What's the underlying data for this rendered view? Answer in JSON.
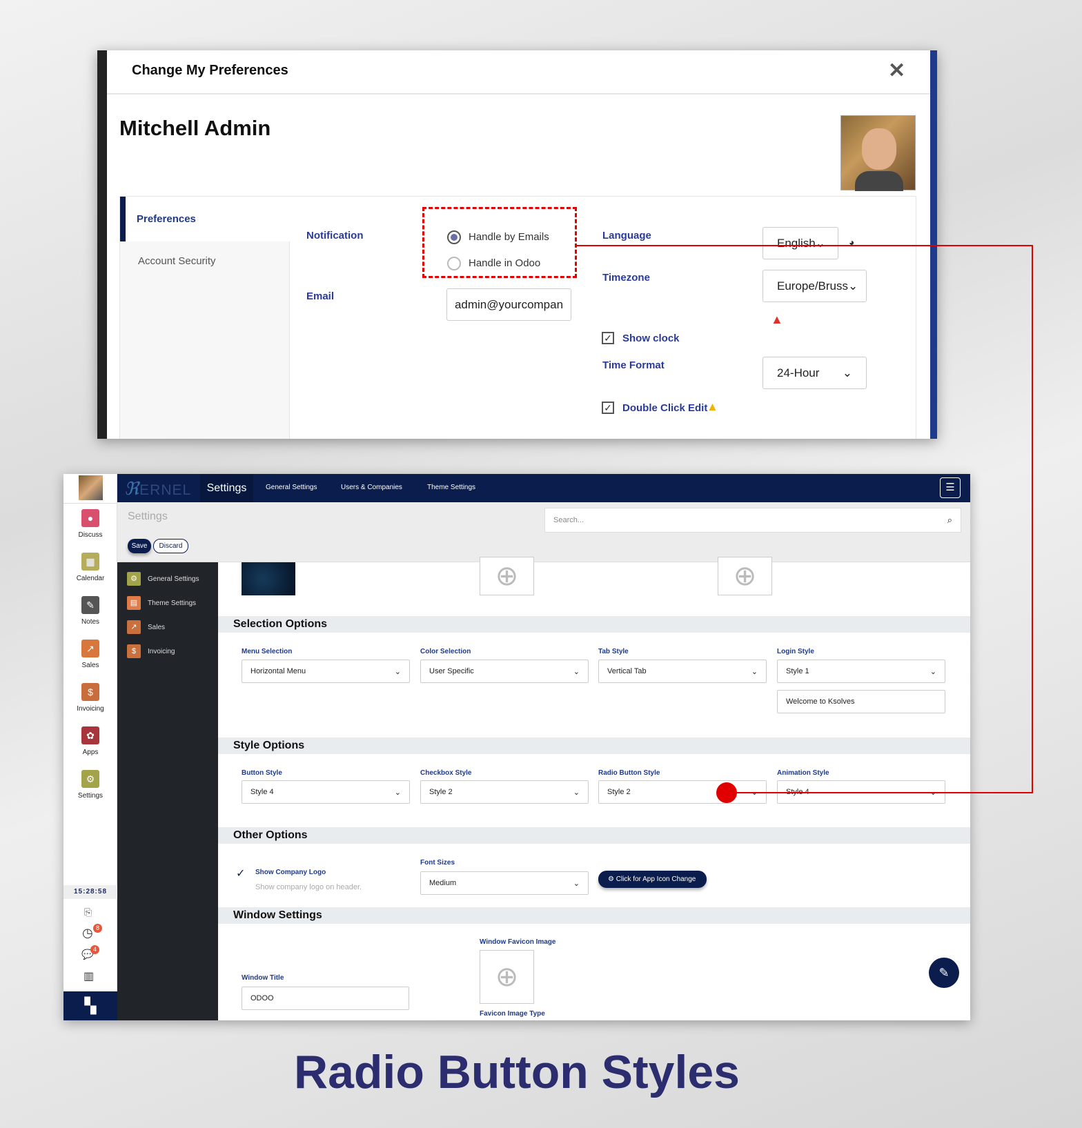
{
  "modal": {
    "title": "Change My Preferences",
    "close": "✕",
    "user_name": "Mitchell Admin",
    "tabs": [
      "Preferences",
      "Account Security"
    ],
    "notification_label": "Notification",
    "notification_options": [
      "Handle by Emails",
      "Handle in Odoo"
    ],
    "notification_selected": "Handle by Emails",
    "email_label": "Email",
    "email_value": "admin@yourcompan",
    "language_label": "Language",
    "language_value": "English",
    "timezone_label": "Timezone",
    "timezone_value": "Europe/Bruss",
    "show_clock_label": "Show clock",
    "time_format_label": "Time Format",
    "time_format_value": "24-Hour",
    "double_click_label": "Double Click Edit"
  },
  "app": {
    "logo": "ERNEL",
    "nav_title": "Settings",
    "nav_items": [
      "General Settings",
      "Users & Companies",
      "Theme Settings"
    ],
    "apps": [
      "Discuss",
      "Calendar",
      "Notes",
      "Sales",
      "Invoicing",
      "Apps",
      "Settings"
    ],
    "clock": "15:28:58",
    "activity_badge": "8",
    "messages_badge": "4",
    "breadcrumb": "Settings",
    "search_placeholder": "Search...",
    "save": "Save",
    "discard": "Discard",
    "sidebar": [
      "General Settings",
      "Theme Settings",
      "Sales",
      "Invoicing"
    ],
    "sections": {
      "selection": "Selection Options",
      "style": "Style Options",
      "other": "Other Options",
      "window": "Window Settings"
    },
    "selection_fields": [
      {
        "label": "Menu Selection",
        "value": "Horizontal Menu"
      },
      {
        "label": "Color Selection",
        "value": "User Specific"
      },
      {
        "label": "Tab Style",
        "value": "Vertical Tab"
      },
      {
        "label": "Login Style",
        "value": "Style 1"
      }
    ],
    "login_text": "Welcome to Ksolves",
    "style_fields": [
      {
        "label": "Button Style",
        "value": "Style 4"
      },
      {
        "label": "Checkbox Style",
        "value": "Style 2"
      },
      {
        "label": "Radio Button Style",
        "value": "Style 2"
      },
      {
        "label": "Animation Style",
        "value": "Style 4"
      }
    ],
    "show_logo_label": "Show Company Logo",
    "show_logo_desc": "Show company logo on header.",
    "font_sizes_label": "Font Sizes",
    "font_sizes_value": "Medium",
    "app_icon_button": "Click for App Icon Change",
    "window_title_label": "Window Title",
    "window_title_value": "ODOO",
    "favicon_label": "Window Favicon Image",
    "favicon_type_label": "Favicon Image Type"
  },
  "caption": "Radio Button Styles",
  "colors": {
    "navy": "#0b1d4d",
    "label": "#1e3a8a",
    "highlight": "#e00000",
    "caption": "#2b2d6e"
  }
}
